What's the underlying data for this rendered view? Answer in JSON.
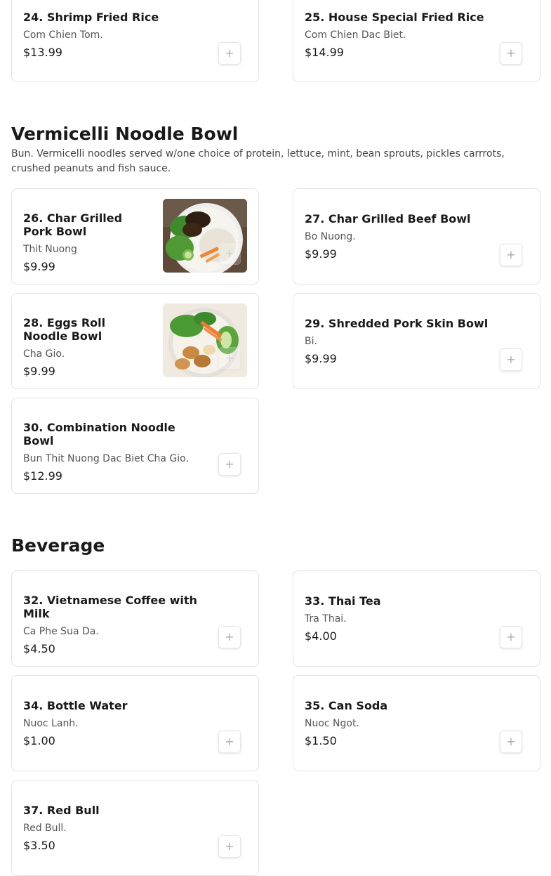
{
  "top_items": [
    {
      "name": "24. Shrimp Fried Rice",
      "description": "Com Chien Tom.",
      "price": "$13.99"
    },
    {
      "name": "25. House Special Fried Rice",
      "description": "Com Chien Dac Biet.",
      "price": "$14.99"
    }
  ],
  "vermicelli": {
    "title": "Vermicelli Noodle Bowl",
    "description": "Bun. Vermicelli noodles served w/one choice of protein, lettuce, mint, bean sprouts, pickles carrrots, crushed peanuts and fish sauce.",
    "items": [
      {
        "name": "26. Char Grilled Pork Bowl",
        "description": "Thit Nuong",
        "price": "$9.99",
        "image": "grilled-pork-bowl-photo"
      },
      {
        "name": "27. Char Grilled Beef Bowl",
        "description": "Bo Nuong.",
        "price": "$9.99"
      },
      {
        "name": "28. Eggs Roll Noodle Bowl",
        "description": "Cha Gio.",
        "price": "$9.99",
        "image": "egg-roll-bowl-photo"
      },
      {
        "name": "29. Shredded Pork Skin Bowl",
        "description": "Bi.",
        "price": "$9.99"
      },
      {
        "name": "30. Combination Noodle Bowl",
        "description": "Bun Thit Nuong Dac Biet Cha Gio.",
        "price": "$12.99"
      }
    ]
  },
  "beverage": {
    "title": "Beverage",
    "items": [
      {
        "name": "32. Vietnamese Coffee with Milk",
        "description": "Ca Phe Sua Da.",
        "price": "$4.50"
      },
      {
        "name": "33. Thai Tea",
        "description": "Tra Thai.",
        "price": "$4.00"
      },
      {
        "name": "34. Bottle Water",
        "description": "Nuoc Lanh.",
        "price": "$1.00"
      },
      {
        "name": "35. Can Soda",
        "description": "Nuoc Ngot.",
        "price": "$1.50"
      },
      {
        "name": "37. Red Bull",
        "description": "Red Bull.",
        "price": "$3.50"
      }
    ]
  },
  "add_button_icon": "plus-icon",
  "colors": {
    "border": "#e3e3e3",
    "text": "#1a1a1a",
    "muted": "#555555"
  }
}
